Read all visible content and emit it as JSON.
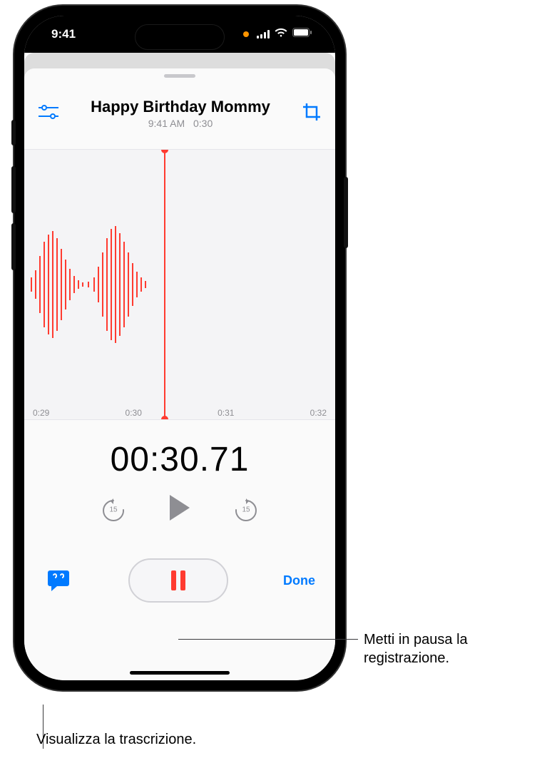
{
  "status": {
    "time": "9:41"
  },
  "recording": {
    "title": "Happy Birthday Mommy",
    "time_label": "9:41 AM",
    "duration_label": " 0:30"
  },
  "timeline": {
    "ticks": [
      "0:29",
      "0:30",
      "0:31",
      "0:32"
    ]
  },
  "timer": "00:30.71",
  "controls": {
    "skip_back": "15",
    "skip_fwd": "15",
    "done": "Done"
  },
  "callouts": {
    "pause": "Metti in pausa la\nregistrazione.",
    "transcript": "Visualizza la trascrizione."
  }
}
